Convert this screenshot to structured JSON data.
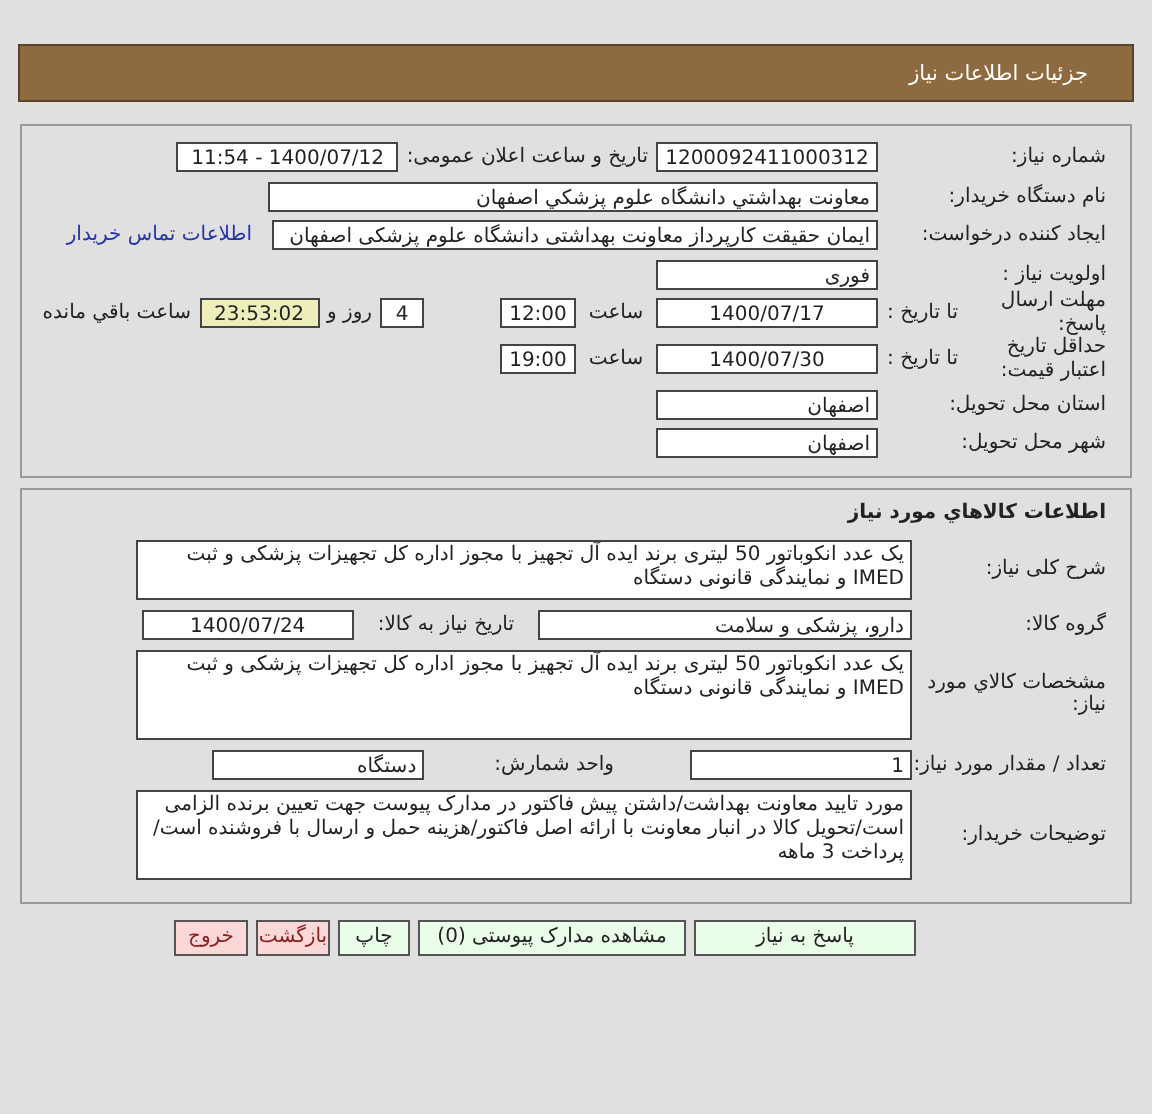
{
  "header": {
    "title": "جزئیات اطلاعات نیاز"
  },
  "need": {
    "number": {
      "label": "شماره نیاز:",
      "value": "1200092411000312"
    },
    "announce": {
      "label": "تاریخ و ساعت اعلان عمومی:",
      "value": "1400/07/12 - 11:54"
    },
    "buyer": {
      "label": "نام دستگاه خریدار:",
      "value": "معاونت بهداشتي دانشگاه علوم پزشکي اصفهان"
    },
    "creator": {
      "label": "ایجاد کننده درخواست:",
      "value": "ایمان حقیقت کارپرداز معاونت بهداشتی دانشگاه علوم پزشکی اصفهان",
      "link": "اطلاعات تماس خریدار"
    },
    "priority": {
      "label": "اولویت نیاز :",
      "value": "فوری"
    },
    "deadline": {
      "label": "مهلت ارسال پاسخ:",
      "to_label": "تا تاریخ :",
      "date": "1400/07/17",
      "time_label": "ساعت",
      "time": "12:00",
      "days": "4",
      "days_label": "روز و",
      "remaining": "23:53:02",
      "remaining_label": "ساعت باقي مانده"
    },
    "validity": {
      "label": "حداقل تاریخ اعتبار قیمت:",
      "to_label": "تا تاریخ :",
      "date": "1400/07/30",
      "time_label": "ساعت",
      "time": "19:00"
    },
    "province": {
      "label": "استان محل تحویل:",
      "value": "اصفهان"
    },
    "city": {
      "label": "شهر محل تحویل:",
      "value": "اصفهان"
    }
  },
  "goods": {
    "title": "اطلاعات کالاهاي مورد نياز",
    "summary": {
      "label": "شرح کلی نیاز:",
      "value": "یک عدد انکوباتور 50 لیتری برند ایده آل تجهیز با مجوز اداره کل تجهیزات پزشکی و ثبت IMED و نمایندگی قانونی دستگاه"
    },
    "group": {
      "label": "گروه کالا:",
      "value": "دارو، پزشکی و سلامت"
    },
    "need_date": {
      "label": "تاریخ نیاز به کالا:",
      "value": "1400/07/24"
    },
    "specs": {
      "label": "مشخصات کالاي مورد نياز:",
      "value": "یک عدد انکوباتور 50 لیتری برند ایده آل تجهیز با مجوز اداره کل تجهیزات پزشکی و ثبت IMED و نمایندگی قانونی دستگاه"
    },
    "quantity": {
      "label": "تعداد / مقدار مورد نیاز:",
      "value": "1"
    },
    "unit": {
      "label": "واحد شمارش:",
      "value": "دستگاه"
    },
    "notes": {
      "label": "توضیحات خریدار:",
      "value": "مورد تایید معاونت بهداشت/داشتن پیش فاکتور در مدارک پیوست جهت تعیین برنده الزامی است/تحویل کالا در انبار معاونت با ارائه اصل فاکتور/هزینه حمل و ارسال با فروشنده است/ پرداخت 3 ماهه"
    }
  },
  "buttons": [
    {
      "label": "پاسخ به نیاز",
      "kind": "action"
    },
    {
      "label": "مشاهده مدارک پیوستی (0)",
      "kind": "action"
    },
    {
      "label": "چاپ",
      "kind": "action"
    },
    {
      "label": "بازگشت",
      "kind": "exit"
    },
    {
      "label": "خروج",
      "kind": "exit"
    }
  ]
}
